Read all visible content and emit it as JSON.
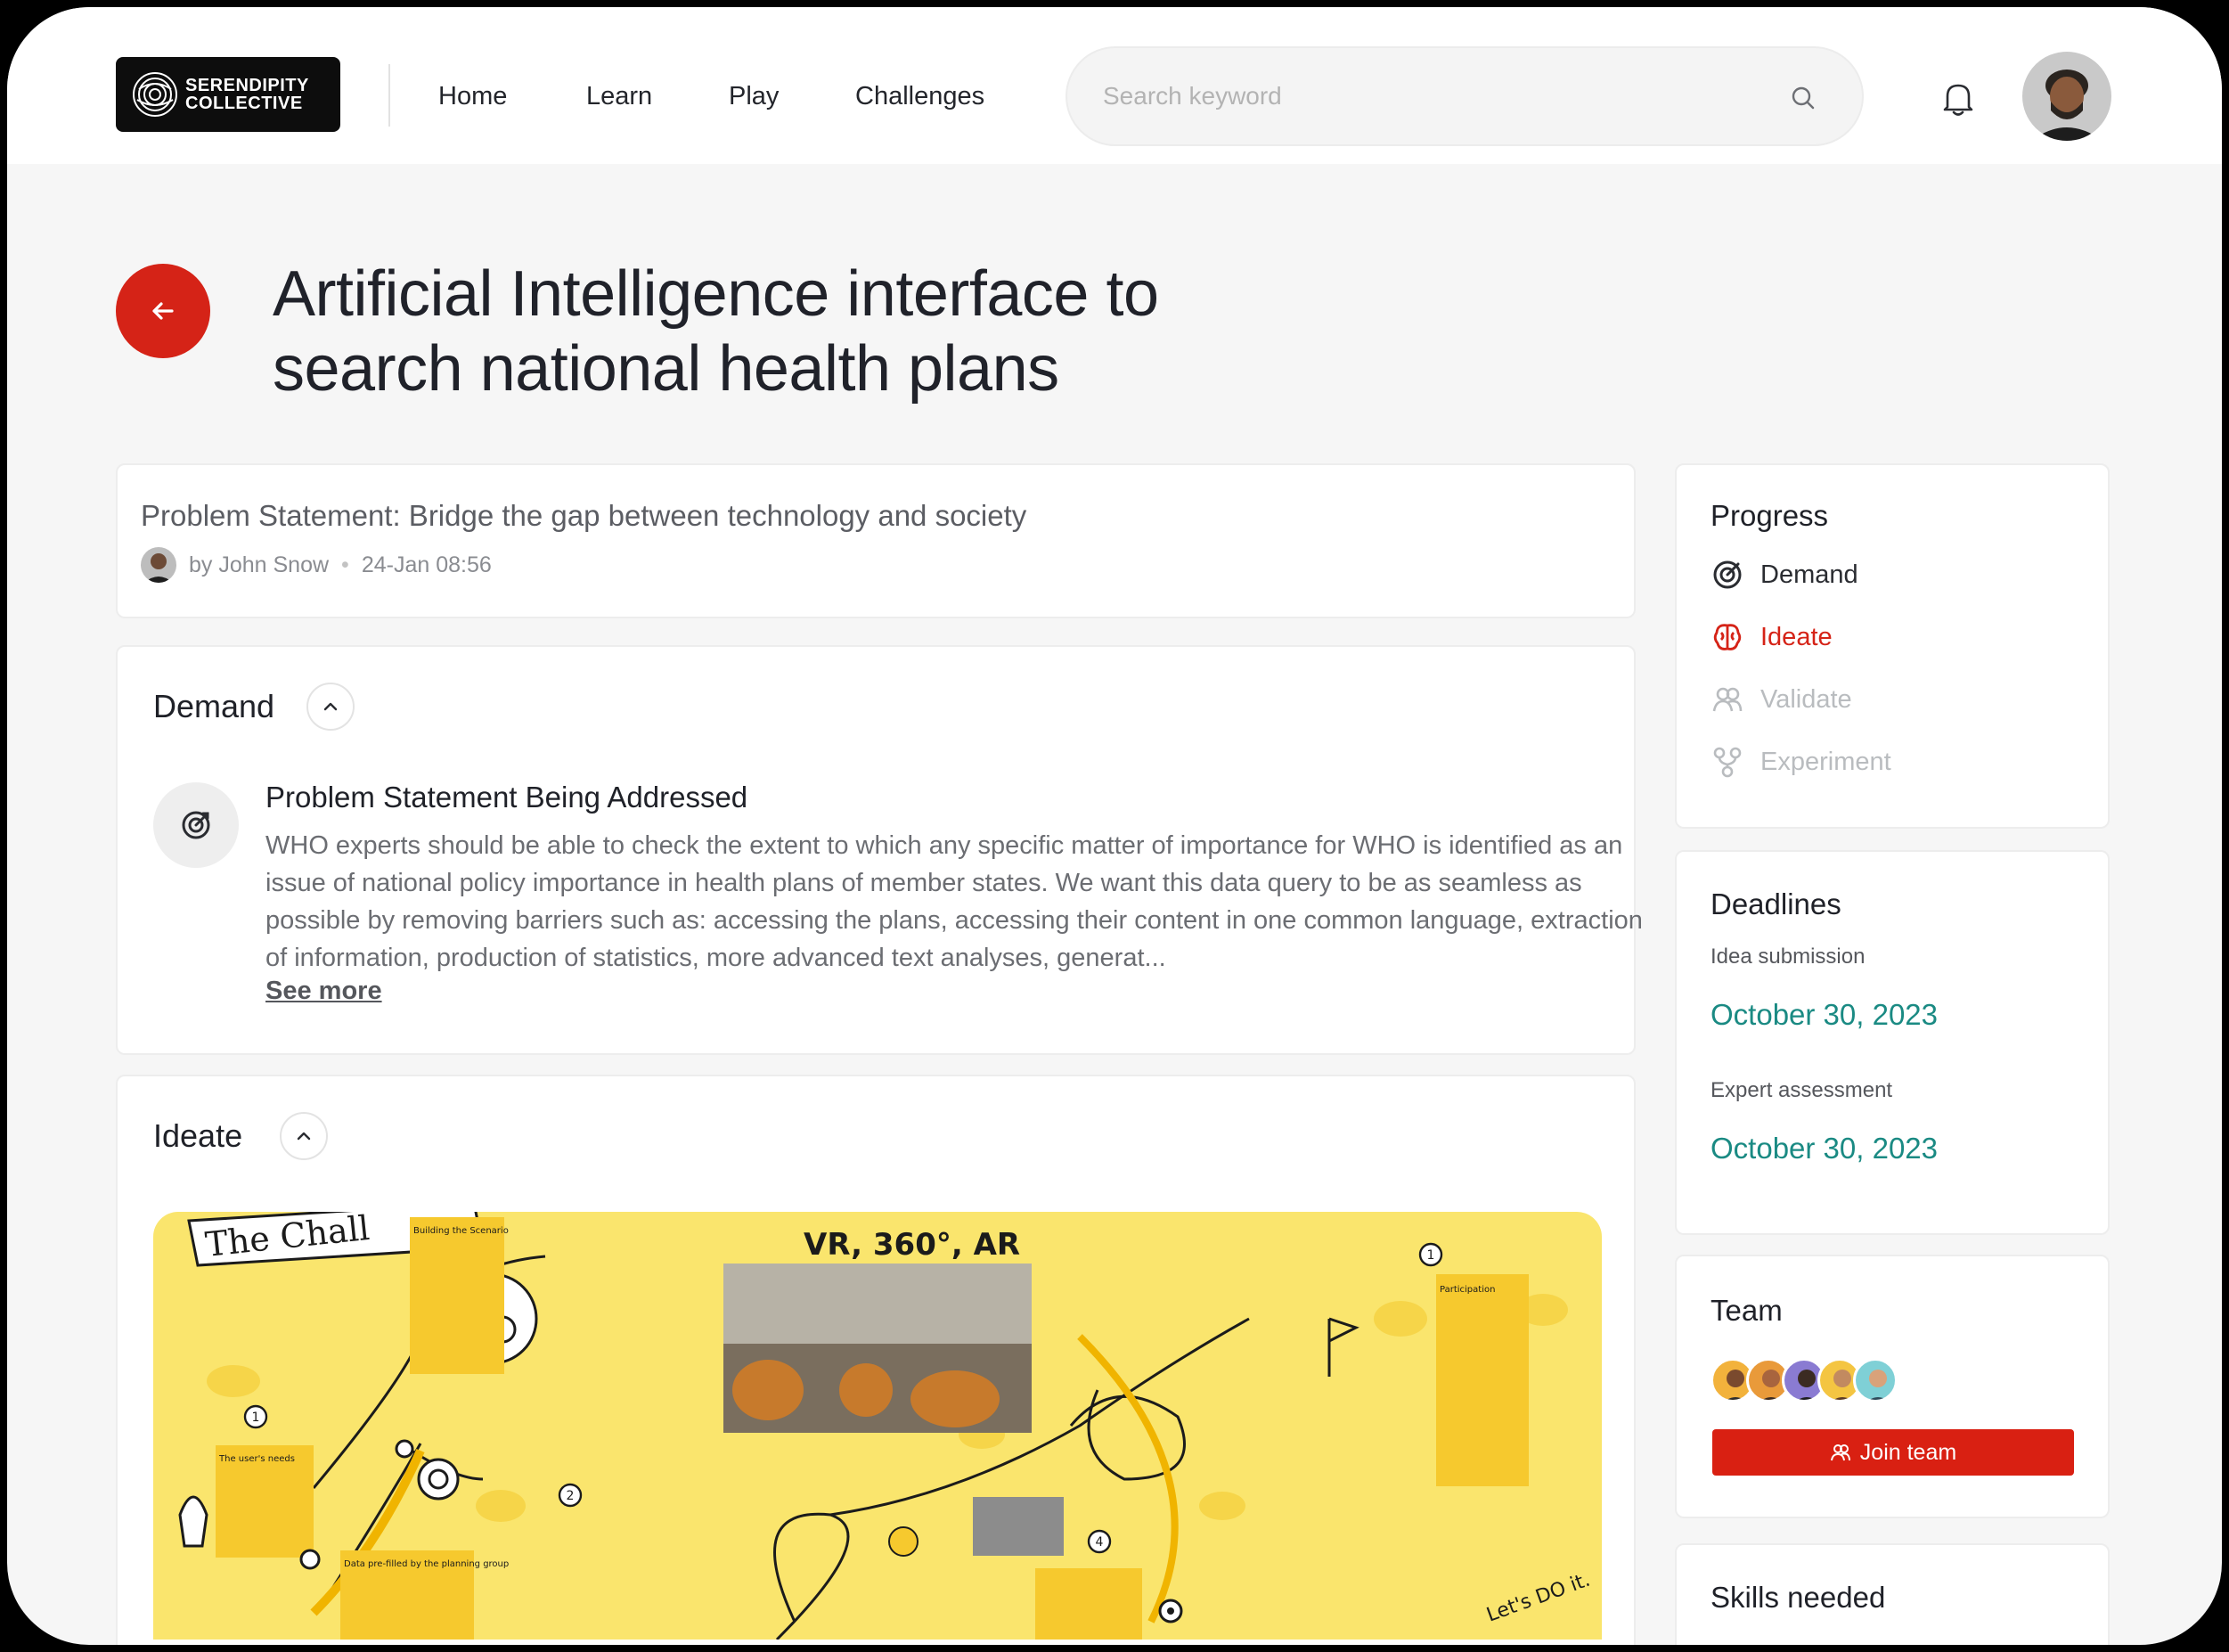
{
  "brand": {
    "logo_text_line1": "SERENDIPITY",
    "logo_text_line2": "COLLECTIVE"
  },
  "nav": {
    "items": [
      "Home",
      "Learn",
      "Play",
      "Challenges"
    ]
  },
  "search": {
    "placeholder": "Search keyword"
  },
  "page": {
    "title_line1": "Artificial Intelligence interface to",
    "title_line2": "search national health plans"
  },
  "problem_card": {
    "title": "Problem Statement: Bridge the gap between technology and society",
    "author": "by John Snow",
    "timestamp": "24-Jan 08:56"
  },
  "demand": {
    "heading": "Demand",
    "item_title": "Problem Statement Being Addressed",
    "item_text": "WHO experts should be able to check the extent to which any specific matter of importance for WHO is identified as an issue of national policy importance in health plans of member states. We want this data query to be as seamless as possible by removing barriers such as: accessing the plans, accessing their content in one common language, extraction of information, production of statistics, more advanced text analyses, generat...",
    "see_more": "See more"
  },
  "ideate": {
    "heading": "Ideate",
    "sketch": {
      "banner": "The Chall",
      "vr_title": "VR, 360°, AR",
      "lets_do_it": "Let's DO it.",
      "step_numbers": [
        "1",
        "1",
        "2",
        "4"
      ],
      "note_building_scenario": "Building the Scenario",
      "note_participation": "Participation",
      "note_users_needs": "The user's needs",
      "note_data_prefilled": "Data pre-filled by the planning group"
    }
  },
  "progress": {
    "heading": "Progress",
    "steps": [
      {
        "label": "Demand",
        "state": "done",
        "icon": "target-icon"
      },
      {
        "label": "Ideate",
        "state": "active",
        "icon": "brain-icon"
      },
      {
        "label": "Validate",
        "state": "pending",
        "icon": "users-icon"
      },
      {
        "label": "Experiment",
        "state": "pending",
        "icon": "branch-icon"
      }
    ]
  },
  "deadlines": {
    "heading": "Deadlines",
    "items": [
      {
        "label": "Idea submission",
        "date": "October 30, 2023"
      },
      {
        "label": "Expert assessment",
        "date": "October 30, 2023"
      }
    ]
  },
  "team": {
    "heading": "Team",
    "join_label": "Join team"
  },
  "skills": {
    "heading": "Skills needed"
  },
  "colors": {
    "accent_red": "#d52317",
    "teal_date": "#1a8a83",
    "sketch_yellow": "#fae56d",
    "active_step": "#d52317",
    "pending_step": "#b9bcbf"
  }
}
